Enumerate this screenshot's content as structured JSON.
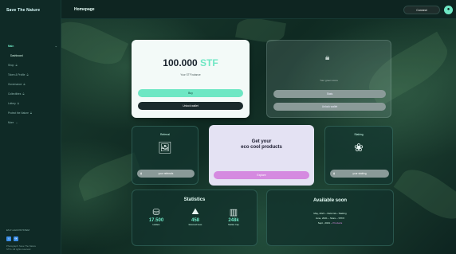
{
  "brand": {
    "logo": "Save The Nature"
  },
  "sidebar": {
    "items": [
      {
        "label": "Main",
        "active": true
      },
      {
        "label": "Dashboard",
        "sub": true
      },
      {
        "label": "Shop"
      },
      {
        "label": "Token & Profile"
      },
      {
        "label": "Governance"
      },
      {
        "label": "Collectibles"
      },
      {
        "label": "Lottery"
      },
      {
        "label": "Protect the Nature"
      },
      {
        "label": "More"
      }
    ],
    "language": "EN ▾  ● ECOSYSTEM",
    "copyright": "Photograph: Save The Nature\nSTN • All rights reserved"
  },
  "topbar": {
    "title": "Homepage",
    "connect_label": "Connect"
  },
  "balance": {
    "amount": "100.000",
    "unit": "STF",
    "subtitle": "Your STF balance",
    "primary_label": "Buy",
    "secondary_label": "Unlock wallet"
  },
  "locked": {
    "subtitle": "Your green score",
    "primary_label": "Stats",
    "secondary_label": "Unlock wallet"
  },
  "referral": {
    "title": "Referral",
    "button_label": "your referrals"
  },
  "shop": {
    "head_line1": "Get your",
    "head_line2": "eco cool products",
    "button_label": "Explore"
  },
  "staking": {
    "title": "Staking",
    "button_label": "your staking"
  },
  "statistics": {
    "title": "Statistics",
    "items": [
      {
        "value": "17.500",
        "label": "Holders"
      },
      {
        "value": "458",
        "label": "Rescued trees"
      },
      {
        "value": "248k",
        "label": "Market Cap"
      }
    ]
  },
  "available_soon": {
    "title": "Available soon",
    "lines": [
      {
        "text": "May, 2021 – Referral + Staking",
        "accent": ""
      },
      {
        "text": "June, 2021 – Store – STFX",
        "accent": ""
      },
      {
        "text": "Sept., 2021 – ",
        "accent": "Products"
      }
    ]
  },
  "colors": {
    "accent": "#6ee7c4",
    "shop_button": "#d58ae0",
    "sidebar_bg": "#0f2a26"
  }
}
